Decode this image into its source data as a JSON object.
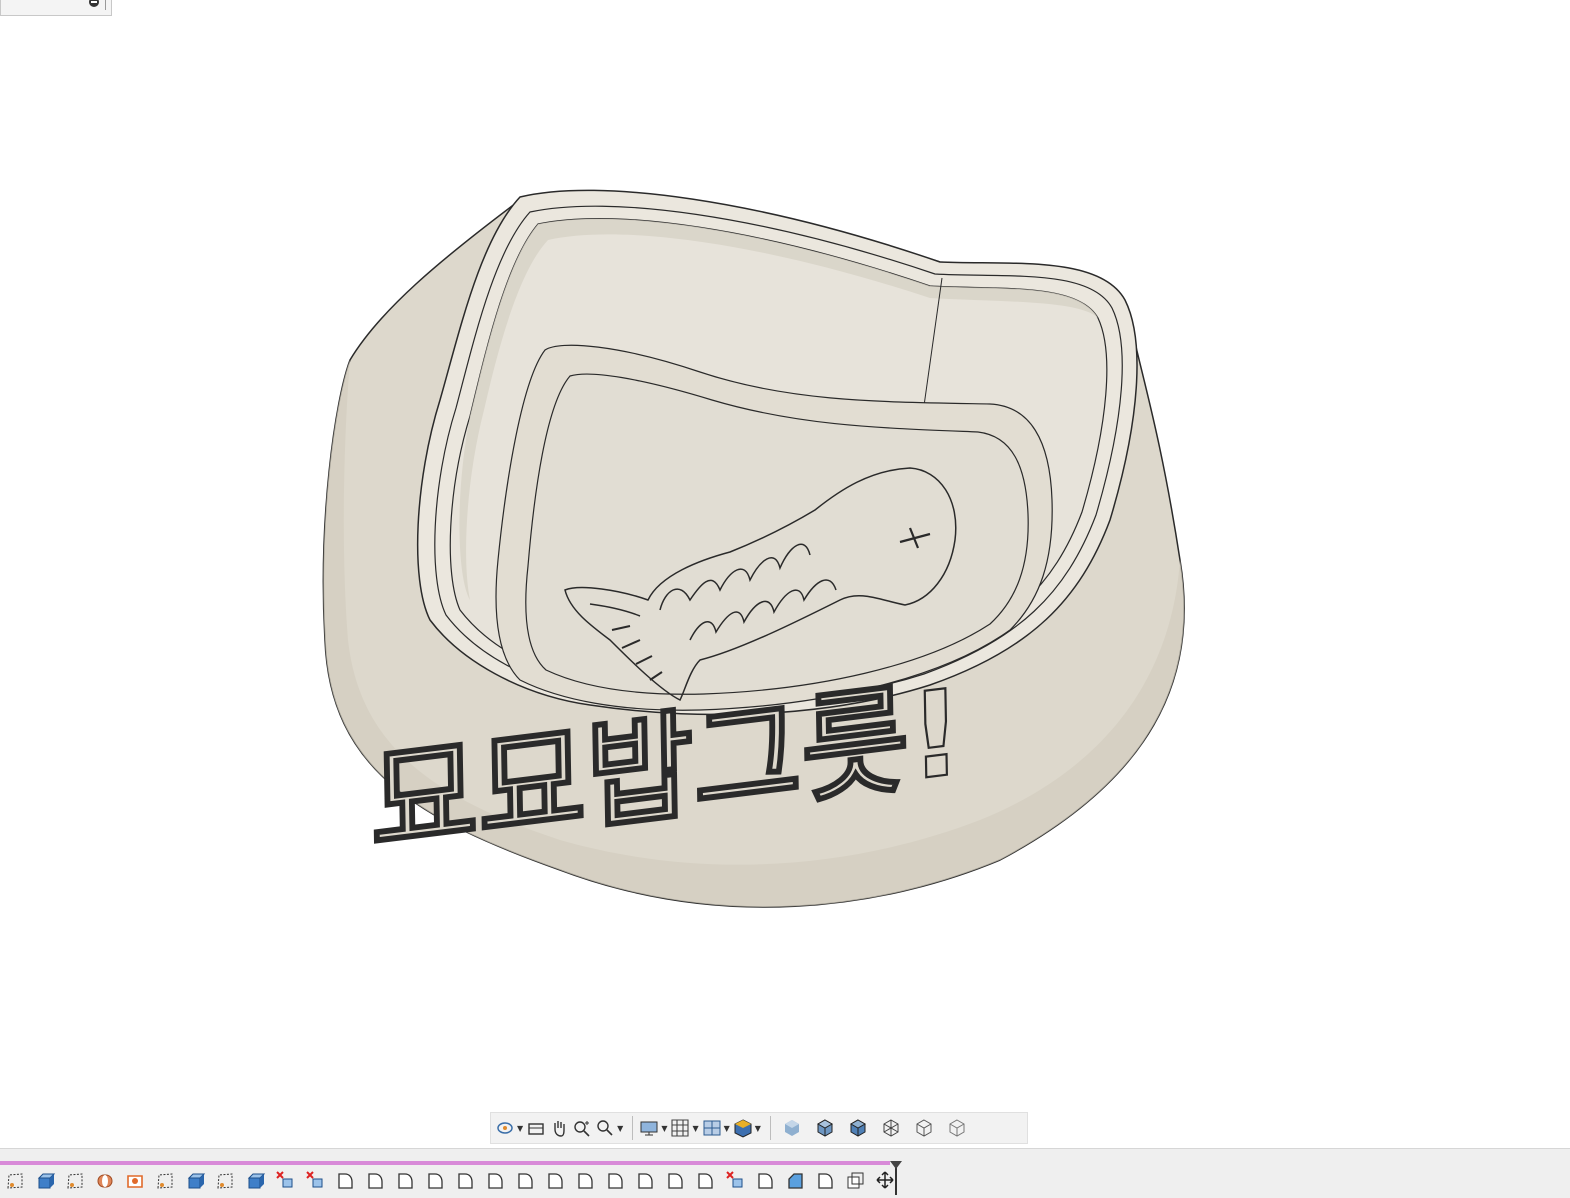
{
  "model": {
    "name": "cat-food-bowl",
    "embossed_text": "묘묘밥그릇!",
    "decal": "fish-skeleton",
    "colors": {
      "surface": "#ddd8cc",
      "inner": "#e6e2d8",
      "shade": "#cfc9bb",
      "edge": "#2a2a2a"
    }
  },
  "nav_toolbar": {
    "items": [
      {
        "name": "orbit-icon",
        "dropdown": true
      },
      {
        "name": "look-at-icon",
        "dropdown": false
      },
      {
        "name": "pan-hand-icon",
        "dropdown": false
      },
      {
        "name": "zoom-icon",
        "dropdown": false
      },
      {
        "name": "fit-window-icon",
        "dropdown": true
      },
      {
        "name": "display-settings-icon",
        "dropdown": true
      },
      {
        "name": "grid-snap-icon",
        "dropdown": true
      },
      {
        "name": "viewports-icon",
        "dropdown": true
      },
      {
        "name": "environment-icon",
        "dropdown": true
      }
    ],
    "visual_styles": [
      "shaded-icon",
      "shaded-edges-icon",
      "shaded-hidden-edges-icon",
      "wireframe-icon",
      "wireframe-hidden-edges-icon",
      "wireframe-visible-edges-icon"
    ]
  },
  "timeline": {
    "progress_color": "#d88ad8",
    "features": [
      "sketch-icon",
      "extrude-icon",
      "sketch-icon",
      "revolve-icon",
      "shell-icon",
      "sketch-icon",
      "extrude-icon",
      "sketch-icon",
      "extrude-icon",
      "delete-body-icon",
      "delete-body-icon",
      "fillet-icon",
      "fillet-icon",
      "fillet-icon",
      "fillet-icon",
      "fillet-icon",
      "fillet-icon",
      "fillet-icon",
      "fillet-icon",
      "fillet-icon",
      "fillet-icon",
      "fillet-icon",
      "fillet-icon",
      "fillet-icon",
      "delete-body-icon",
      "fillet-icon",
      "chamfer-icon",
      "fillet-icon",
      "offset-face-icon",
      "move-icon"
    ]
  }
}
